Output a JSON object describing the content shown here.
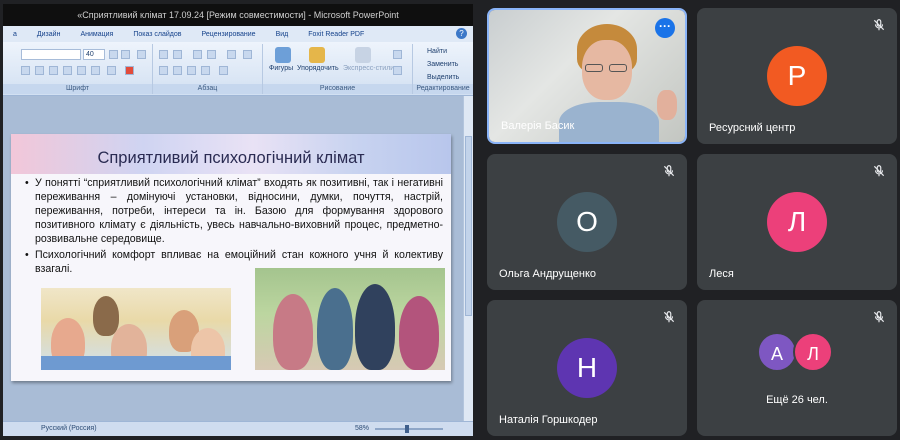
{
  "ppt": {
    "window_title": "«Сприятливий клімат 17.09.24 [Режим совместимости] - Microsoft PowerPoint",
    "tabs": [
      "а",
      "Дизайн",
      "Анимация",
      "Показ слайдов",
      "Рецензирование",
      "Вид",
      "Foxit Reader PDF"
    ],
    "groups": [
      "Шрифт",
      "Абзац",
      "Рисование",
      "Редактирование"
    ],
    "font_size": "40",
    "tools": {
      "shapes": "Фигуры",
      "arrange": "Упорядочить",
      "quick_styles": "Экспресс-стили",
      "find": "Найти",
      "replace": "Заменить",
      "select": "Выделить"
    },
    "status": {
      "language": "Русский (Россия)",
      "zoom": "58%"
    }
  },
  "slide": {
    "title": "Сприятливий психологічний клімат",
    "bullet_1": "У понятті “сприятливий психологічний клімат” входять як позитивні, так і негативні переживання – домінуючі установки, відносини, думки, почуття, настрій, переживання, потреби, інтереси та ін. Базою для формування здорового позитивного клімату є діяльність, увесь навчально-виховний процес, предметно-розвивальне середовище.",
    "bullet_2": "Психологічний комфорт впливає на емоційний стан кожного учня й колективу взагалі."
  },
  "participants": [
    {
      "name": "Валерія Басик",
      "type": "video",
      "icon": "more-options-icon"
    },
    {
      "name": "Ресурсний центр",
      "initial": "Р",
      "color": "#f25a22",
      "icon": "mic-off-icon"
    },
    {
      "name": "Ольга Андрущенко",
      "initial": "О",
      "color": "#455a64",
      "icon": "mic-off-icon"
    },
    {
      "name": "Леся",
      "initial": "Л",
      "color": "#ec407a",
      "icon": "mic-off-icon"
    },
    {
      "name": "Наталія Горшкодер",
      "initial": "Н",
      "color": "#5e35b1",
      "icon": "mic-off-icon"
    },
    {
      "initials": [
        "А",
        "Л"
      ],
      "colors": [
        "#7e57c2",
        "#ec407a"
      ],
      "more_label": "Ещё 26 чел.",
      "icon": "mic-off-icon"
    }
  ]
}
